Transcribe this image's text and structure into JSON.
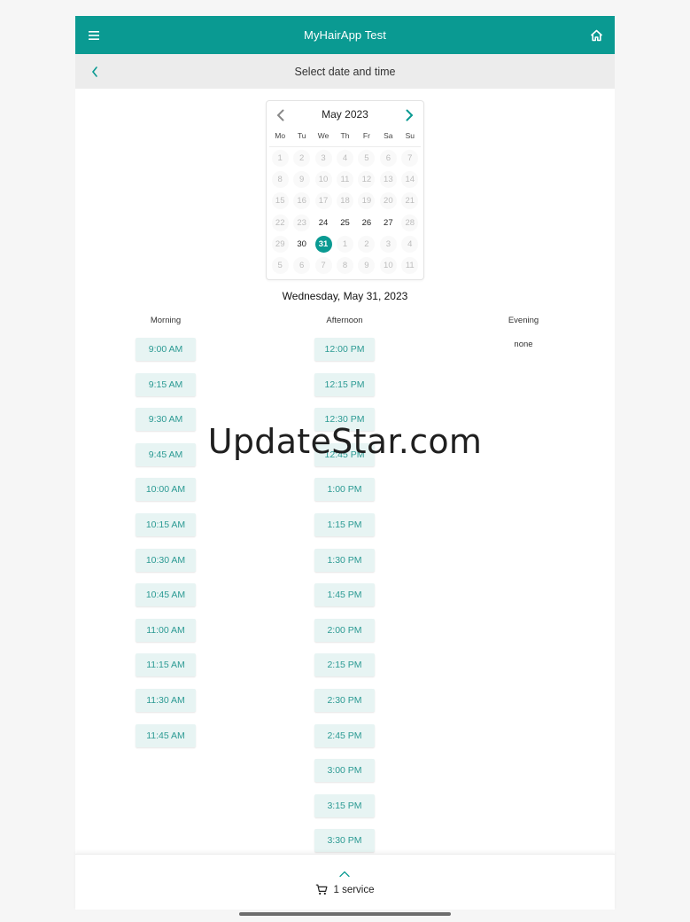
{
  "appbar": {
    "title": "MyHairApp Test",
    "menu_icon": "menu-icon",
    "home_icon": "home-icon",
    "color": "#0a9a92"
  },
  "subbar": {
    "title": "Select date and time",
    "back_icon": "chevron-left-icon"
  },
  "calendar": {
    "month_label": "May 2023",
    "weekdays": [
      "Mo",
      "Tu",
      "We",
      "Th",
      "Fr",
      "Sa",
      "Su"
    ],
    "days": [
      {
        "label": "1",
        "state": "disabled"
      },
      {
        "label": "2",
        "state": "disabled"
      },
      {
        "label": "3",
        "state": "disabled"
      },
      {
        "label": "4",
        "state": "disabled"
      },
      {
        "label": "5",
        "state": "disabled"
      },
      {
        "label": "6",
        "state": "disabled"
      },
      {
        "label": "7",
        "state": "disabled"
      },
      {
        "label": "8",
        "state": "disabled"
      },
      {
        "label": "9",
        "state": "disabled"
      },
      {
        "label": "10",
        "state": "disabled"
      },
      {
        "label": "11",
        "state": "disabled"
      },
      {
        "label": "12",
        "state": "disabled"
      },
      {
        "label": "13",
        "state": "disabled"
      },
      {
        "label": "14",
        "state": "disabled"
      },
      {
        "label": "15",
        "state": "disabled"
      },
      {
        "label": "16",
        "state": "disabled"
      },
      {
        "label": "17",
        "state": "disabled"
      },
      {
        "label": "18",
        "state": "disabled"
      },
      {
        "label": "19",
        "state": "disabled"
      },
      {
        "label": "20",
        "state": "disabled"
      },
      {
        "label": "21",
        "state": "disabled"
      },
      {
        "label": "22",
        "state": "disabled"
      },
      {
        "label": "23",
        "state": "disabled"
      },
      {
        "label": "24",
        "state": "active"
      },
      {
        "label": "25",
        "state": "active"
      },
      {
        "label": "26",
        "state": "active"
      },
      {
        "label": "27",
        "state": "active"
      },
      {
        "label": "28",
        "state": "disabled"
      },
      {
        "label": "29",
        "state": "disabled"
      },
      {
        "label": "30",
        "state": "active"
      },
      {
        "label": "31",
        "state": "selected"
      },
      {
        "label": "1",
        "state": "disabled"
      },
      {
        "label": "2",
        "state": "disabled"
      },
      {
        "label": "3",
        "state": "disabled"
      },
      {
        "label": "4",
        "state": "disabled"
      },
      {
        "label": "5",
        "state": "disabled"
      },
      {
        "label": "6",
        "state": "disabled"
      },
      {
        "label": "7",
        "state": "disabled"
      },
      {
        "label": "8",
        "state": "disabled"
      },
      {
        "label": "9",
        "state": "disabled"
      },
      {
        "label": "10",
        "state": "disabled"
      },
      {
        "label": "11",
        "state": "disabled"
      }
    ]
  },
  "selected_date": "Wednesday, May 31, 2023",
  "columns": {
    "morning": {
      "title": "Morning",
      "slots": [
        "9:00 AM",
        "9:15 AM",
        "9:30 AM",
        "9:45 AM",
        "10:00 AM",
        "10:15 AM",
        "10:30 AM",
        "10:45 AM",
        "11:00 AM",
        "11:15 AM",
        "11:30 AM",
        "11:45 AM"
      ]
    },
    "afternoon": {
      "title": "Afternoon",
      "slots": [
        "12:00 PM",
        "12:15 PM",
        "12:30 PM",
        "12:45 PM",
        "1:00 PM",
        "1:15 PM",
        "1:30 PM",
        "1:45 PM",
        "2:00 PM",
        "2:15 PM",
        "2:30 PM",
        "2:45 PM",
        "3:00 PM",
        "3:15 PM",
        "3:30 PM"
      ]
    },
    "evening": {
      "title": "Evening",
      "empty_text": "none"
    }
  },
  "watermark": "UpdateStar.com",
  "bottom": {
    "cart_label": "1 service",
    "cart_icon": "cart-icon",
    "expand_icon": "chevron-up-icon"
  }
}
